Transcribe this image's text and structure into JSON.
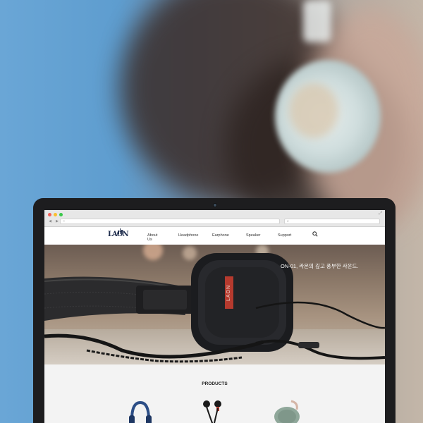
{
  "site": {
    "logo_text": "LAON",
    "nav": [
      {
        "label": "About Us"
      },
      {
        "label": "Headphone"
      },
      {
        "label": "Earphone"
      },
      {
        "label": "Speaker"
      },
      {
        "label": "Support"
      }
    ]
  },
  "hero": {
    "tagline": "ON-01, 라온의 깊고 풍부한 사운드.",
    "product_badge": "LAON"
  },
  "products": {
    "title": "PRODUCTS",
    "items": [
      {
        "icon": "headphone-product-icon"
      },
      {
        "icon": "earphone-product-icon"
      },
      {
        "icon": "speaker-product-icon"
      }
    ]
  },
  "colors": {
    "brand": "#1f2d4d",
    "background_blue": "#5e9dcf",
    "accent_red": "#b63a2e"
  }
}
